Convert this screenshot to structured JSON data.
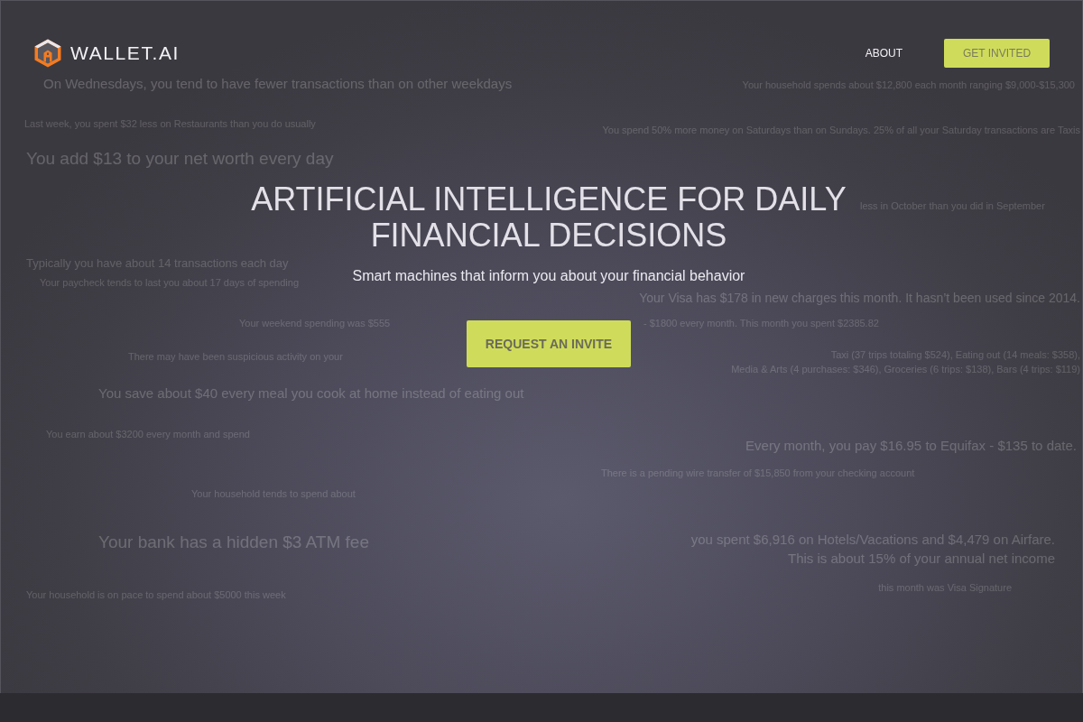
{
  "header": {
    "logo": "WALLET.AI",
    "nav": [
      {
        "label": "ABOUT",
        "kind": "link"
      },
      {
        "label": "GET INVITED",
        "kind": "button"
      }
    ]
  },
  "hero": {
    "title": "ARTIFICIAL INTELLIGENCE FOR DAILY FINANCIAL DECISIONS",
    "subtitle": "Smart machines that inform you about your financial behavior",
    "cta": "REQUEST AN INVITE"
  },
  "insights": [
    "On Wednesdays, you tend to have fewer transactions than on other weekdays",
    "Your household spends about $12,800 each month ranging $9,000-$15,300",
    "Last week, you spent $32 less on Restaurants than you do usually",
    "You spend 50% more money on Saturdays than on Sundays. 25% of all your Saturday transactions are Taxis",
    "You add $13 to your net worth every day",
    "less in October than you did in September",
    "Typically you have about 14 transactions each day",
    "Your paycheck tends to last you about 17 days of spending",
    "Your Visa has $178 in new charges this month. It hasn’t been used since 2014.",
    "Your weekend spending was $555",
    "- $1800 every month. This month you spent $2385.82",
    "There may have been suspicious activity on your",
    "Taxi (37 trips totaling $524), Eating out (14 meals: $358),",
    "Media & Arts (4 purchases: $346), Groceries (6 trips: $138), Bars (4 trips: $119)",
    "You save about $40 every meal you cook at home instead of eating out",
    "You earn about $3200 every month and spend",
    "Every month, you pay $16.95 to Equifax - $135 to date.",
    "There is a pending wire transfer of $15,850 from your checking account",
    "Your household tends to spend about",
    "Your bank has a hidden $3 ATM fee",
    "you spent $6,916 on Hotels/Vacations and $4,479 on Airfare.",
    "This is about 15% of your annual net income",
    "this month was Visa Signature",
    "Your household is on pace to spend about $5000 this week"
  ]
}
